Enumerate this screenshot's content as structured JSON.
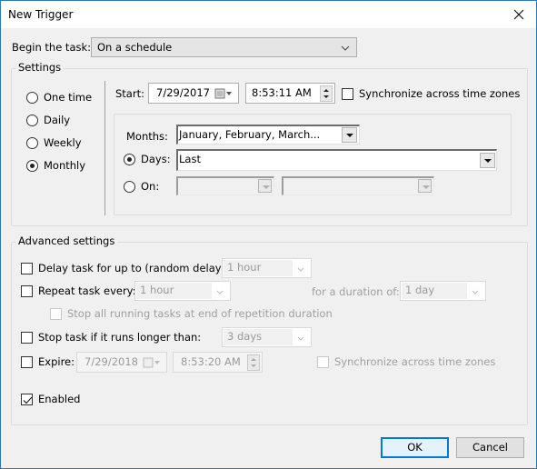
{
  "window": {
    "title": "New Trigger"
  },
  "begin": {
    "label": "Begin the task:",
    "value": "On a schedule"
  },
  "settings": {
    "title": "Settings",
    "frequency": [
      {
        "label": "One time",
        "selected": false
      },
      {
        "label": "Daily",
        "selected": false
      },
      {
        "label": "Weekly",
        "selected": false
      },
      {
        "label": "Monthly",
        "selected": true
      }
    ],
    "start_label": "Start:",
    "start_date": "7/29/2017",
    "start_time": "8:53:11 AM",
    "sync_label": "Synchronize across time zones",
    "sync_checked": false,
    "months_label": "Months:",
    "months_value": "January, February, March...",
    "days_label": "Days:",
    "days_value": "Last",
    "days_selected": true,
    "on_label": "On:",
    "on_selected": false,
    "on_value_1": "",
    "on_value_2": ""
  },
  "advanced": {
    "title": "Advanced settings",
    "delay_label": "Delay task for up to (random delay):",
    "delay_value": "1 hour",
    "delay_checked": false,
    "repeat_label": "Repeat task every:",
    "repeat_value": "1 hour",
    "repeat_checked": false,
    "duration_label": "for a duration of:",
    "duration_value": "1 day",
    "stop_all_label": "Stop all running tasks at end of repetition duration",
    "stop_label": "Stop task if it runs longer than:",
    "stop_value": "3 days",
    "stop_checked": false,
    "expire_label": "Expire:",
    "expire_date": "7/29/2018",
    "expire_time": "8:53:20 AM",
    "expire_checked": false,
    "expire_sync_label": "Synchronize across time zones",
    "enabled_label": "Enabled",
    "enabled_checked": true
  },
  "buttons": {
    "ok": "OK",
    "cancel": "Cancel"
  }
}
